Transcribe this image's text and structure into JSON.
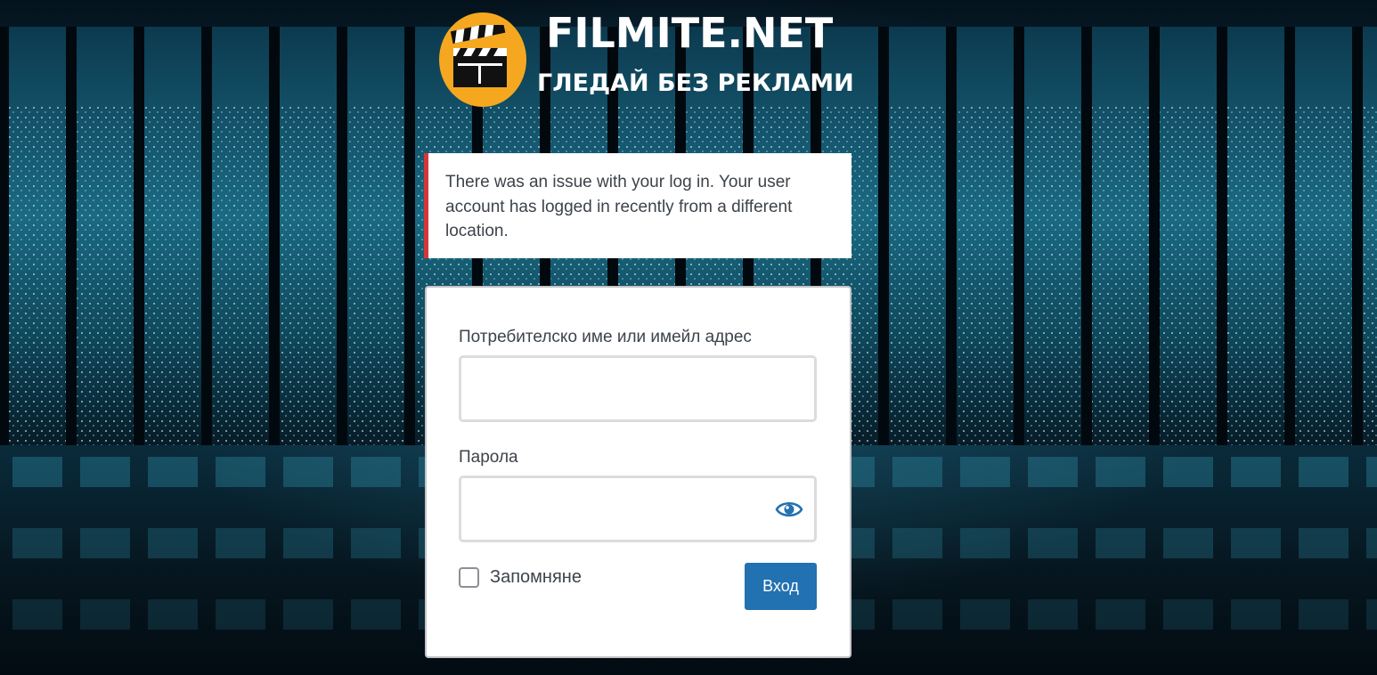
{
  "brand": {
    "title": "FILMITE.NET",
    "tagline": "ГЛЕДАЙ БЕЗ РЕКЛАМИ",
    "logo_icon": "clapperboard-icon",
    "logo_color": "#f5a81f"
  },
  "notice": {
    "message": "There was an issue with your log in. Your user account has logged in recently from a different location.",
    "accent_color": "#d63638"
  },
  "login_form": {
    "username_label": "Потребителско име или имейл адрес",
    "username_value": "",
    "password_label": "Парола",
    "password_value": "",
    "show_password_icon": "eye-icon",
    "remember_label": "Запомняне",
    "remember_checked": false,
    "submit_label": "Вход",
    "submit_color": "#2271b1"
  }
}
